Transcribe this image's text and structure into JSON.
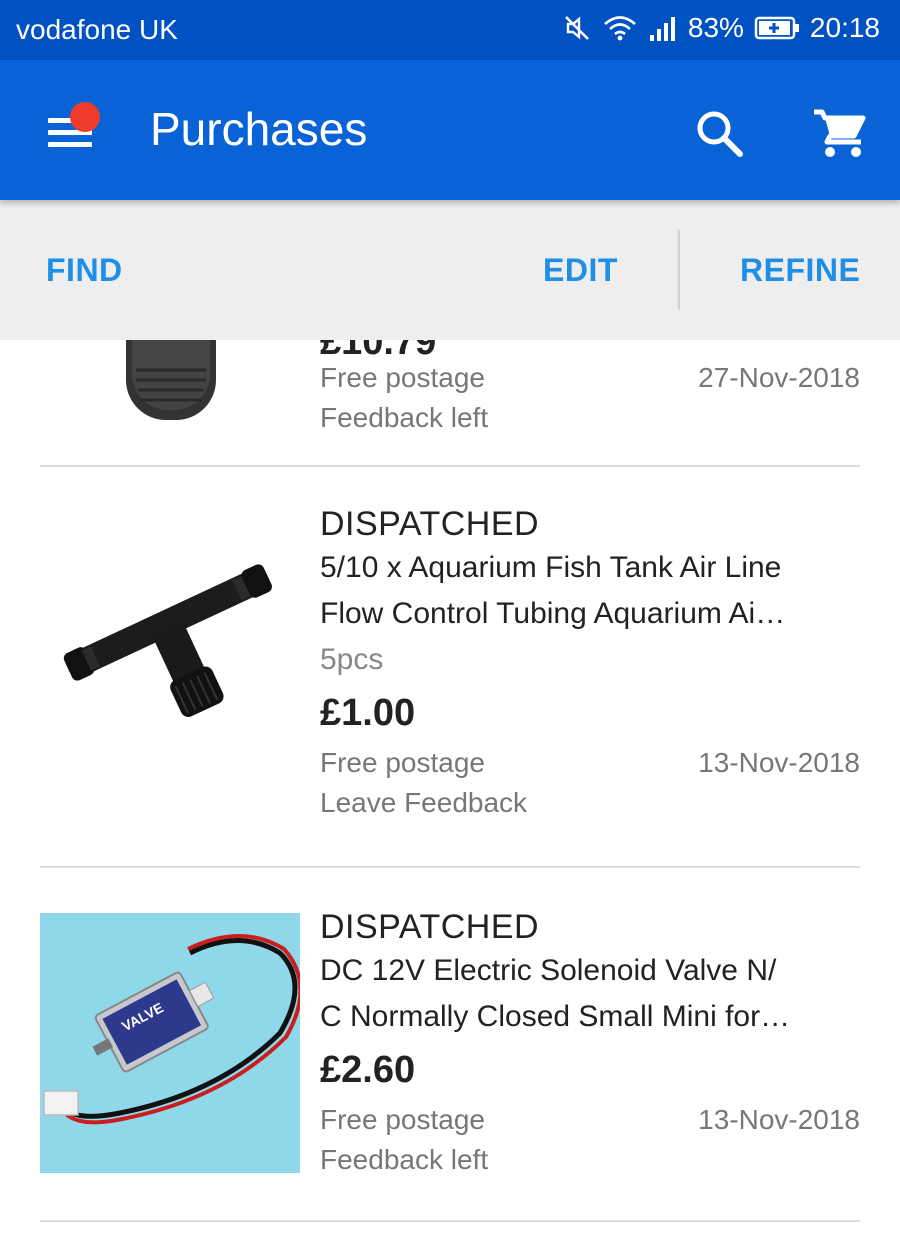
{
  "status_bar": {
    "carrier": "vodafone UK",
    "battery": "83%",
    "time": "20:18",
    "icons": [
      "mute-icon",
      "wifi-icon",
      "signal-icon",
      "battery-charging-icon"
    ]
  },
  "app_bar": {
    "title": "Purchases",
    "icons": [
      "menu-icon",
      "search-icon",
      "cart-icon"
    ],
    "notification_dot_color": "#ee3b2b",
    "background": "#0a63d6"
  },
  "actions": {
    "find": "FIND",
    "edit": "EDIT",
    "refine": "REFINE",
    "color": "#1f8ee6"
  },
  "purchases": [
    {
      "price_partial": "£10.79",
      "postage": "Free postage",
      "feedback": "Feedback left",
      "date": "27-Nov-2018",
      "image": "tyre-image"
    },
    {
      "status": "DISPATCHED",
      "title_line1": "5/10 x Aquarium Fish Tank Air Line",
      "title_line2": "Flow Control Tubing Aquarium Ai…",
      "variant": "5pcs",
      "price": "£1.00",
      "postage": "Free postage",
      "feedback": "Leave Feedback",
      "date": "13-Nov-2018",
      "image": "air-valve-image"
    },
    {
      "status": "DISPATCHED",
      "title_line1": "DC 12V Electric Solenoid Valve N/",
      "title_line2": "C Normally Closed Small Mini for…",
      "price": "£2.60",
      "postage": "Free postage",
      "feedback": "Feedback left",
      "date": "13-Nov-2018",
      "image": "solenoid-valve-image",
      "image_label": "VALVE"
    }
  ]
}
